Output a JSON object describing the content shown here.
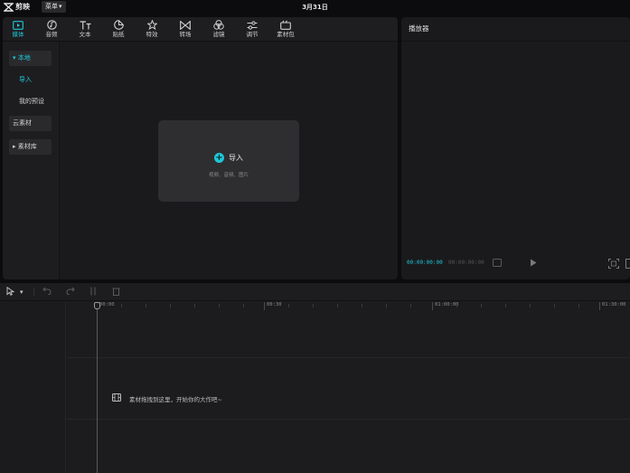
{
  "app": {
    "name": "剪映",
    "menu_label": "菜单",
    "window_title": "3月31日"
  },
  "categories": [
    {
      "label": "媒体",
      "icon": "media-icon",
      "active": true
    },
    {
      "label": "音频",
      "icon": "audio-icon"
    },
    {
      "label": "文本",
      "icon": "text-icon"
    },
    {
      "label": "贴纸",
      "icon": "sticker-icon"
    },
    {
      "label": "特效",
      "icon": "effects-icon"
    },
    {
      "label": "转场",
      "icon": "transition-icon"
    },
    {
      "label": "滤镜",
      "icon": "filter-icon"
    },
    {
      "label": "调节",
      "icon": "adjust-icon"
    },
    {
      "label": "素材包",
      "icon": "package-icon"
    }
  ],
  "sidebar": {
    "items": [
      {
        "label": "本地"
      },
      {
        "label": "导入"
      },
      {
        "label": "我的预设"
      },
      {
        "label": "云素材"
      },
      {
        "label": "素材库"
      }
    ]
  },
  "import": {
    "label": "导入",
    "hint": "视频、音频、图片"
  },
  "player": {
    "title": "播放器",
    "current_time": "00:00:00:00",
    "total_time": "00:00:00:00"
  },
  "timeline": {
    "ruler_labels": [
      "00:00",
      "00:30",
      "01:00:00",
      "01:30:00"
    ],
    "empty_hint": "素材拖拽到这里，开始你的大作吧~"
  },
  "colors": {
    "accent": "#1ec8d8",
    "panel": "#1a1a1c",
    "background": "#0c0c0e"
  }
}
